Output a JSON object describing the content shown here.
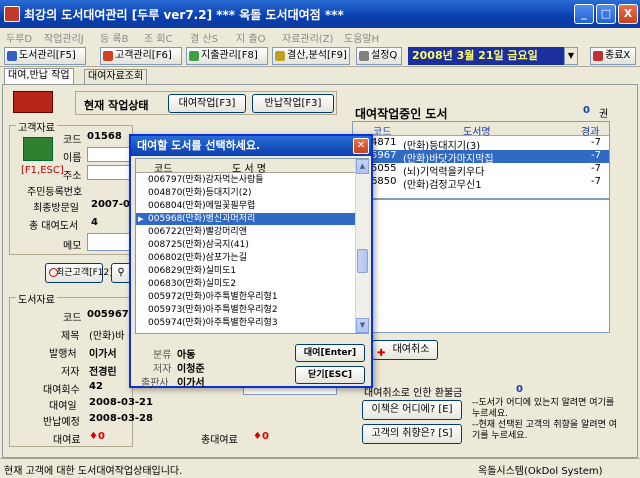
{
  "window": {
    "title": "최강의 도서대여관리 [두루 ver7.2] *** 옥돌 도서대여점 ***",
    "buttons": [
      "_",
      "□",
      "X"
    ]
  },
  "menu": [
    "두루D",
    "작업관리J",
    "등 록B",
    "조 회C",
    "결 산S",
    "지 출O",
    "자료관리(Z)",
    "도움말H"
  ],
  "toolbar": {
    "books": "도서관리[F5]",
    "customers": "고객관리[F6]",
    "expense": "지출관리[F8]",
    "settle": "결산,분석[F9]",
    "settings": "설정Q",
    "date": "2008년  3월 21일 금요일",
    "exit": "종료X"
  },
  "tabs": [
    "대여,반납 작업",
    "대여자료조회"
  ],
  "work": {
    "status_label": "현재 작업상태",
    "rent_btn": "대여작업[F3]",
    "return_btn": "반납작업[F3]"
  },
  "customer": {
    "group": "고객자료",
    "code_label": "코드",
    "code": "01568",
    "name_label": "이름",
    "addr_label": "주소",
    "hotkey": "[F1,ESC]",
    "regno_label": "주민등록번호",
    "last_visit_label": "최종방문일",
    "last_visit": "2007-05",
    "total_label": "총 대여도서",
    "total": "4",
    "memo_label": "메모"
  },
  "recent": {
    "btn": "최근고객[F12]"
  },
  "book": {
    "group": "도서자료",
    "code_label": "코드",
    "code": "005967",
    "title_label": "제목",
    "title": "(만화)바",
    "publisher_label": "발행처",
    "publisher": "이가서",
    "author_label": "저자",
    "author": "전경린",
    "count_label": "대여회수",
    "count": "42",
    "rent_date_label": "대여일",
    "rent_date": "2008-03-21",
    "due_label": "반납예정",
    "due": "2008-03-28",
    "fee_label": "대여료",
    "fee": "0",
    "total_fee_label": "총대여료",
    "total_fee": "0"
  },
  "rented": {
    "title": "대여작업중인 도서",
    "count": "0",
    "unit": "권",
    "headers": [
      "코드",
      "도서명",
      "경과"
    ],
    "rows": [
      {
        "code": "4871",
        "name": "(만화)등대지기(3)",
        "days": "-7"
      },
      {
        "code": "5967",
        "name": "(만화)바닷가마지막집",
        "days": "-7"
      },
      {
        "code": "5055",
        "name": "(뇌)기억력을키우다",
        "days": "-7"
      },
      {
        "code": "6850",
        "name": "(만화)검정고무신1",
        "days": "-7"
      }
    ],
    "cancel_btn": "대여취소",
    "refund_label": "대여취소로 인한 환불금",
    "refund": "0",
    "where_btn": "이책은 어디에? [E]",
    "where_desc": "--도서가 어디에 있는지 알려면 여기를 누르세요.",
    "taste_btn": "고객의 취향은? [S]",
    "taste_desc": "--현재 선택된 고객의 취향을 알려면 여기를 누르세요."
  },
  "dialog": {
    "title": "대여할 도서를 선택하세요.",
    "headers": [
      "코드",
      "도 서 명"
    ],
    "rows": [
      {
        "code": "006797",
        "name": "(만화)감자먹는사람들"
      },
      {
        "code": "004870",
        "name": "(만화)등대지기(2)"
      },
      {
        "code": "006804",
        "name": "(만화)메밀꽃필무렵"
      },
      {
        "code": "005968",
        "name": "(만화)병신과머저리"
      },
      {
        "code": "006722",
        "name": "(만화)빨강머리앤"
      },
      {
        "code": "008725",
        "name": "(만화)삼국지(41)"
      },
      {
        "code": "006802",
        "name": "(만화)삼포가는길"
      },
      {
        "code": "006829",
        "name": "(만화)실미도1"
      },
      {
        "code": "006830",
        "name": "(만화)실미도2"
      },
      {
        "code": "005972",
        "name": "(만화)아주특별한우리형1"
      },
      {
        "code": "005973",
        "name": "(만화)아주특별한우리형2"
      },
      {
        "code": "005974",
        "name": "(만화)아주특별한우리형3"
      }
    ],
    "selected_index": 3,
    "category_label": "분류",
    "category": "아동",
    "author_label": "저자",
    "author": "이청준",
    "publisher_label": "출판사",
    "publisher": "이가서",
    "rent_btn": "대여[Enter]",
    "close_btn": "닫기[ESC]"
  },
  "status": {
    "left": "현재 고객에 대한 도서대여작업상태입니다.",
    "right": "옥돌시스템(OkDol System)"
  }
}
